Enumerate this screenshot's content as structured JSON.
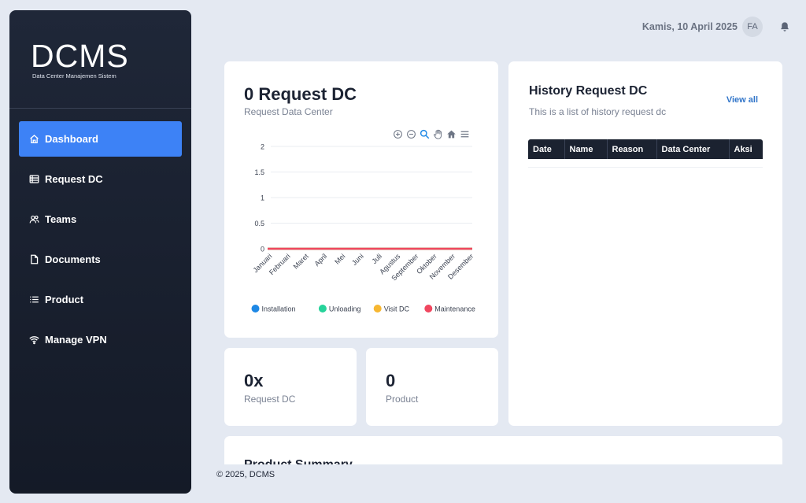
{
  "brand": {
    "logo": "DCMS",
    "subtitle": "Data Center Manajemen Sistem"
  },
  "sidebar": {
    "items": [
      {
        "label": "Dashboard",
        "icon": "home-icon",
        "active": true
      },
      {
        "label": "Request DC",
        "icon": "server-icon",
        "active": false
      },
      {
        "label": "Teams",
        "icon": "users-icon",
        "active": false
      },
      {
        "label": "Documents",
        "icon": "file-icon",
        "active": false
      },
      {
        "label": "Product",
        "icon": "list-icon",
        "active": false
      },
      {
        "label": "Manage VPN",
        "icon": "wifi-icon",
        "active": false
      }
    ]
  },
  "header": {
    "date": "Kamis, 10 April 2025",
    "avatar_initials": "FA"
  },
  "chart_card": {
    "title": "0 Request DC",
    "subtitle": "Request Data Center"
  },
  "chart_data": {
    "type": "line",
    "categories": [
      "Januari",
      "Februari",
      "Maret",
      "April",
      "Mei",
      "Juni",
      "Juli",
      "Agustus",
      "September",
      "Oktober",
      "November",
      "Desember"
    ],
    "series": [
      {
        "name": "Installation",
        "color": "#1e88e5",
        "values": [
          0,
          0,
          0,
          0,
          0,
          0,
          0,
          0,
          0,
          0,
          0,
          0
        ]
      },
      {
        "name": "Unloading",
        "color": "#26d39a",
        "values": [
          0,
          0,
          0,
          0,
          0,
          0,
          0,
          0,
          0,
          0,
          0,
          0
        ]
      },
      {
        "name": "Visit DC",
        "color": "#f7b731",
        "values": [
          0,
          0,
          0,
          0,
          0,
          0,
          0,
          0,
          0,
          0,
          0,
          0
        ]
      },
      {
        "name": "Maintenance",
        "color": "#f0475f",
        "values": [
          0,
          0,
          0,
          0,
          0,
          0,
          0,
          0,
          0,
          0,
          0,
          0
        ]
      }
    ],
    "yticks": [
      "0",
      "0.5",
      "1",
      "1.5",
      "2"
    ],
    "ylim": [
      0,
      2
    ],
    "legend": "bottom-center",
    "grid": true
  },
  "stats": [
    {
      "value": "0x",
      "label": "Request DC"
    },
    {
      "value": "0",
      "label": "Product"
    }
  ],
  "history": {
    "title": "History Request DC",
    "subtitle": "This is a list of history request dc",
    "view_all": "View all",
    "columns": [
      "Date",
      "Name",
      "Reason",
      "Data Center",
      "Aksi"
    ]
  },
  "summary": {
    "title": "Product Summary"
  },
  "footer": {
    "text": "© 2025, DCMS"
  }
}
